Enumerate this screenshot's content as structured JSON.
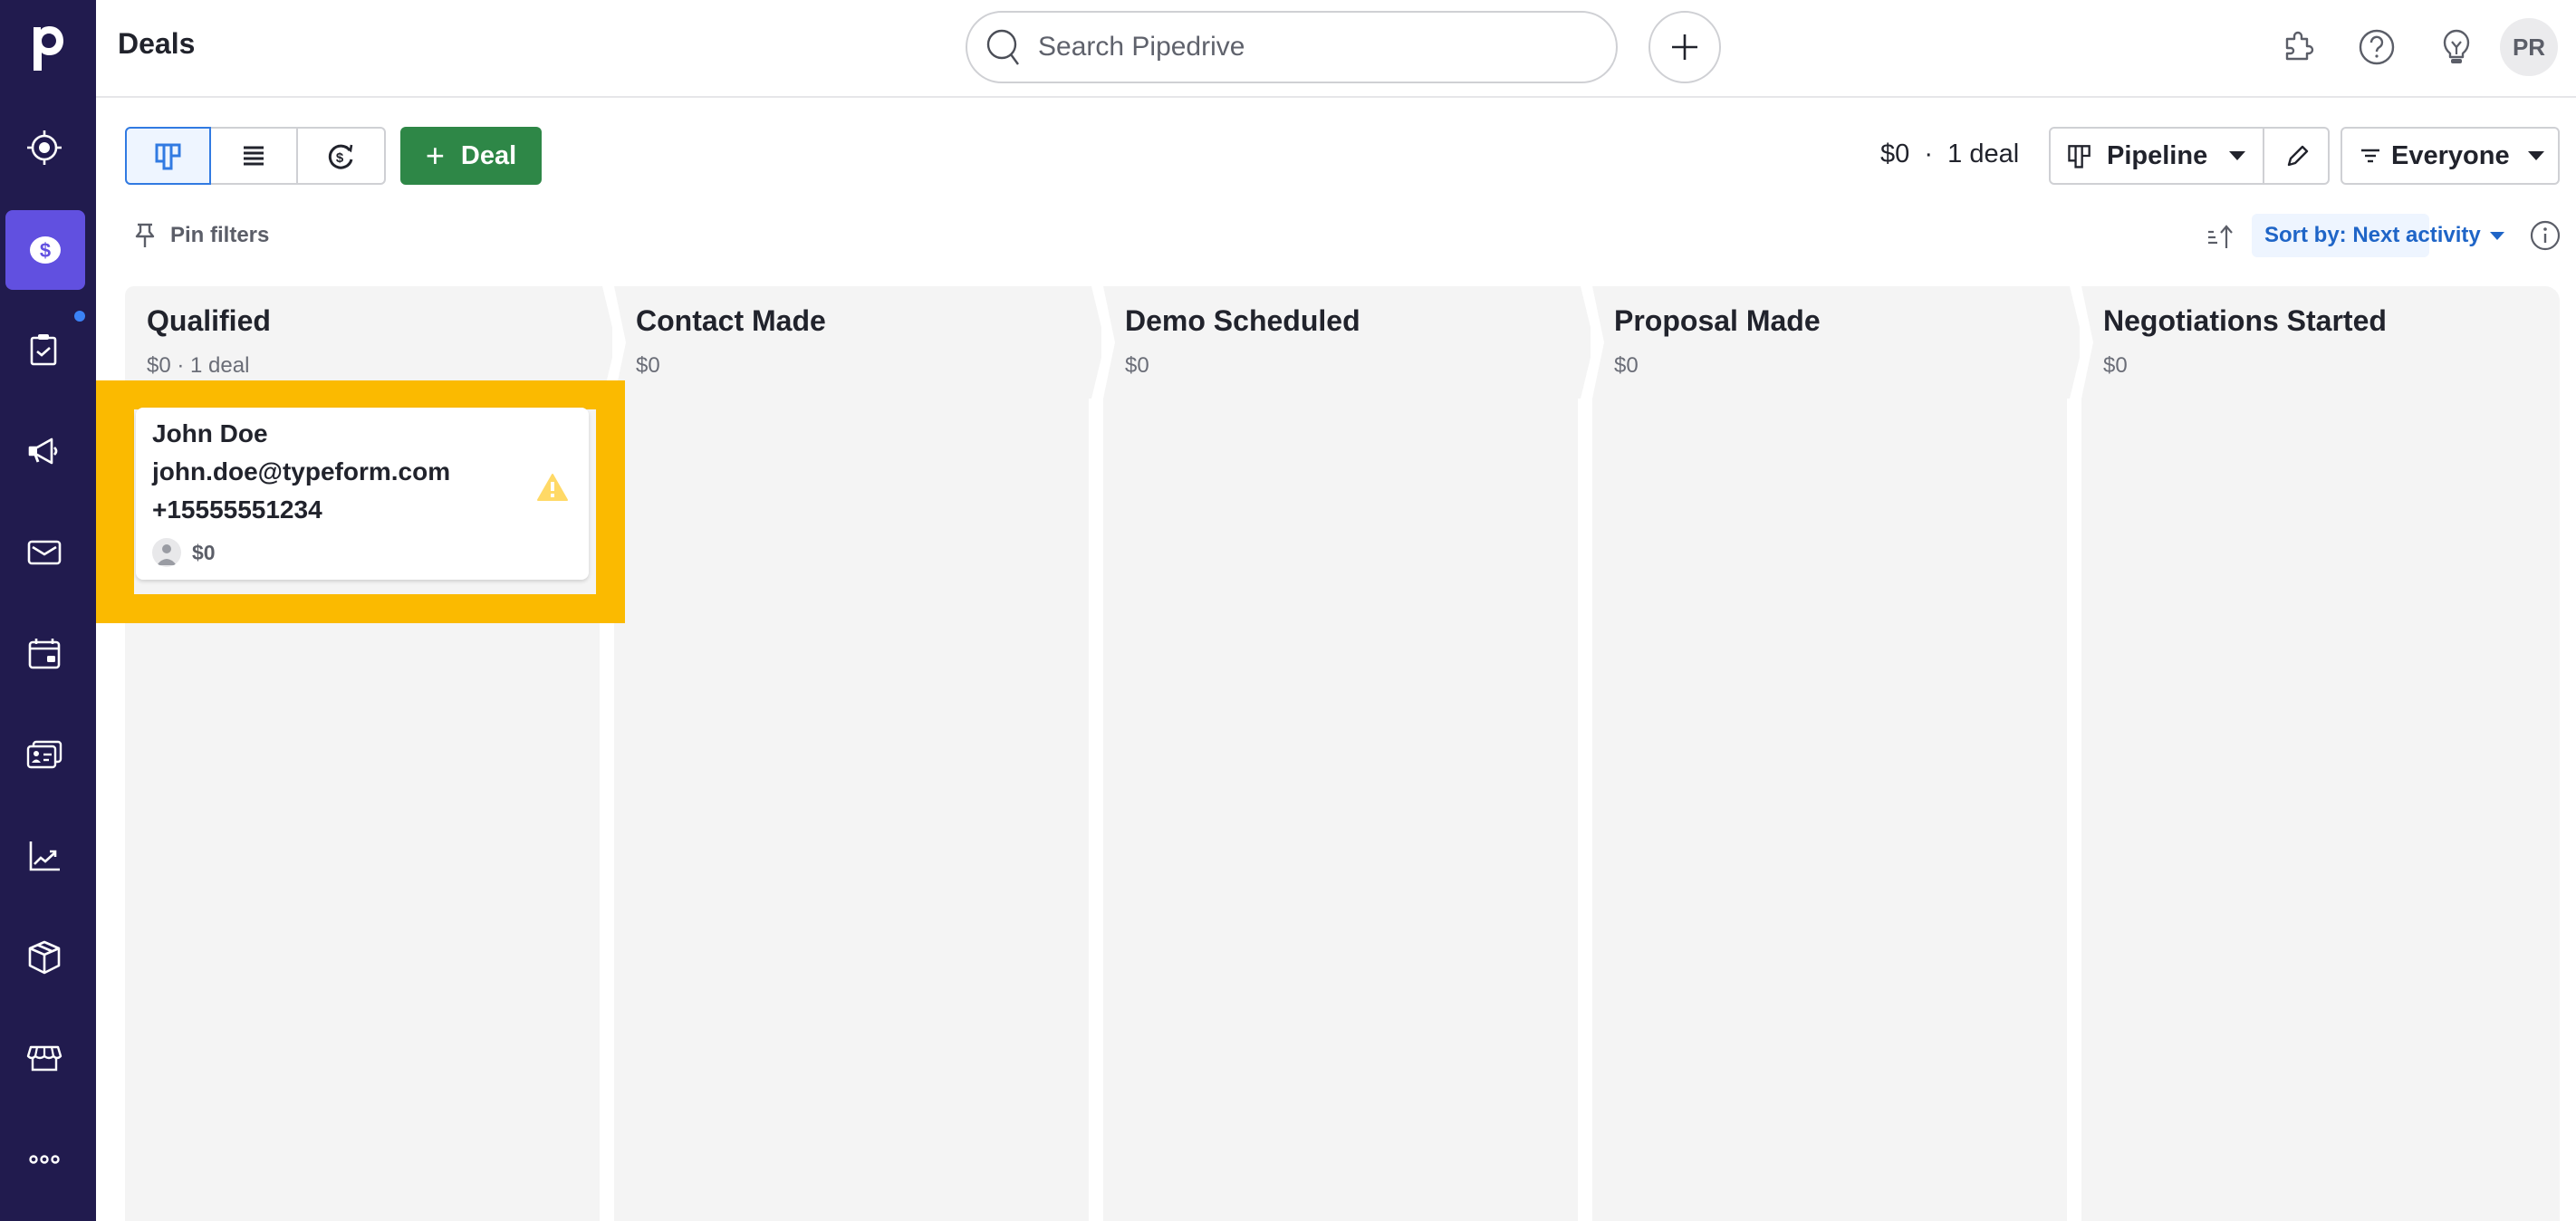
{
  "sidebar": {
    "logo": "p",
    "items": [
      {
        "name": "leads",
        "icon": "target-icon",
        "active": false
      },
      {
        "name": "deals",
        "icon": "dollar-icon",
        "active": true
      },
      {
        "name": "activities",
        "icon": "clipboard-check-icon",
        "active": false,
        "notification_dot": true
      },
      {
        "name": "campaigns",
        "icon": "megaphone-icon",
        "active": false
      },
      {
        "name": "mail",
        "icon": "mail-icon",
        "active": false
      },
      {
        "name": "calendar",
        "icon": "calendar-icon",
        "active": false
      },
      {
        "name": "contacts",
        "icon": "contact-card-icon",
        "active": false
      },
      {
        "name": "insights",
        "icon": "chart-icon",
        "active": false
      },
      {
        "name": "products",
        "icon": "box-icon",
        "active": false
      },
      {
        "name": "marketplace",
        "icon": "store-icon",
        "active": false
      },
      {
        "name": "more",
        "icon": "more-icon",
        "active": false
      }
    ]
  },
  "header": {
    "title": "Deals",
    "search_placeholder": "Search Pipedrive",
    "avatar_initials": "PR",
    "icons": [
      "extensions-icon",
      "help-icon",
      "ideas-icon"
    ]
  },
  "toolbar": {
    "views": [
      {
        "name": "pipeline-view",
        "active": true
      },
      {
        "name": "list-view",
        "active": false
      },
      {
        "name": "forecast-view",
        "active": false
      }
    ],
    "add_deal_label": "Deal",
    "summary": "$0  ·  1 deal",
    "pipeline_label": "Pipeline",
    "owner_filter_label": "Everyone",
    "pin_filters_label": "Pin filters",
    "sort_label": "Sort by: Next activity"
  },
  "stages": [
    {
      "title": "Qualified",
      "meta": "$0 · 1 deal"
    },
    {
      "title": "Contact Made",
      "meta": "$0"
    },
    {
      "title": "Demo Scheduled",
      "meta": "$0"
    },
    {
      "title": "Proposal Made",
      "meta": "$0"
    },
    {
      "title": "Negotiations Started",
      "meta": "$0"
    }
  ],
  "deal_card": {
    "stage": "Qualified",
    "lines": [
      "John Doe",
      "john.doe@typeform.com",
      "+15555551234"
    ],
    "value": "$0",
    "status_icon": "warning-icon",
    "highlighted": true
  },
  "colors": {
    "sidebar_bg": "#211b4e",
    "sidebar_active": "#6150e0",
    "primary_green": "#2e8747",
    "accent_blue": "#317ae2",
    "highlight_yellow": "#fbba00",
    "warning_yellow": "#ffd966",
    "stage_bg": "#f4f4f4"
  }
}
